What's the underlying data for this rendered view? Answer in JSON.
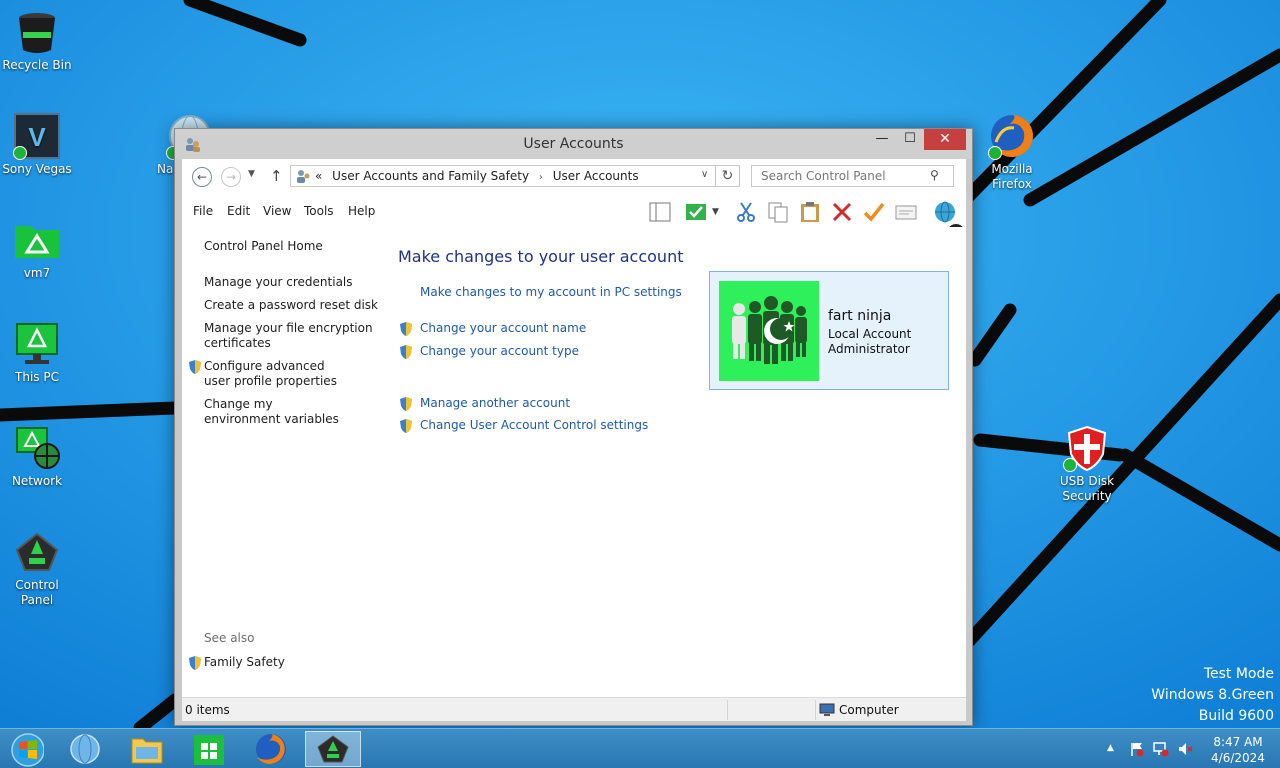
{
  "desktop": {
    "icons_left": [
      {
        "label": "Recycle Bin",
        "icon": "recycle-bin-icon"
      },
      {
        "label": "Sony Vegas",
        "icon": "sony-vegas-icon"
      },
      {
        "label": "vm7",
        "icon": "folder-icon"
      },
      {
        "label": "This PC",
        "icon": "computer-icon"
      },
      {
        "label": "Network",
        "icon": "network-icon"
      },
      {
        "label": "Control Panel",
        "icon": "control-panel-icon"
      }
    ],
    "partial_icon_label": "Na",
    "icons_right": [
      {
        "label": "Mozilla Firefox",
        "icon": "firefox-icon"
      },
      {
        "label": "USB Disk Security",
        "icon": "shield-icon"
      }
    ],
    "watermark": {
      "line1": "Test Mode",
      "line2": "Windows 8.Green",
      "line3": "Build 9600"
    }
  },
  "window": {
    "title": "User Accounts",
    "controls": {
      "minimize": "—",
      "maximize": "☐",
      "close": "✕"
    },
    "address": {
      "prefix": "«",
      "crumbs": [
        "User Accounts and Family Safety",
        "User Accounts"
      ],
      "separator": "›"
    },
    "search": {
      "placeholder": "Search Control Panel"
    },
    "menu": [
      "File",
      "Edit",
      "View",
      "Tools",
      "Help"
    ],
    "left_nav": {
      "home": "Control Panel Home",
      "links": [
        "Manage your credentials",
        "Create a password reset disk",
        "Manage your file encryption certificates",
        "Configure advanced user profile properties",
        "Change my environment variables"
      ],
      "see_also_label": "See also",
      "see_also_links": [
        "Family Safety"
      ]
    },
    "main": {
      "heading": "Make changes to your user account",
      "links": [
        "Make changes to my account in PC settings",
        "Change your account name",
        "Change your account type",
        "Manage another account",
        "Change User Account Control settings"
      ]
    },
    "account": {
      "name": "fart ninja",
      "type": "Local Account",
      "role": "Administrator"
    },
    "status": {
      "items": "0 items",
      "location": "Computer"
    }
  },
  "taskbar": {
    "clock_time": "8:47 AM",
    "clock_date": "4/6/2024",
    "tray_arrow": "▲"
  }
}
